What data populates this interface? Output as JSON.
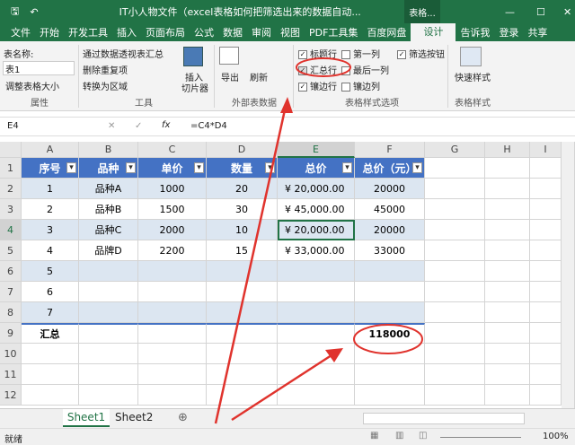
{
  "titlebar": {
    "title": "IT小人物文件（excel表格如何把筛选出来的数据自动...",
    "context": "表格...",
    "undo": "↶",
    "save": "🖫"
  },
  "tabs": [
    "文件",
    "开始",
    "开发工具",
    "插入",
    "页面布局",
    "公式",
    "数据",
    "审阅",
    "视图",
    "PDF工具集",
    "百度网盘",
    "设计"
  ],
  "tab_right": {
    "tell": "告诉我",
    "login": "登录",
    "share": "共享"
  },
  "ribbon": {
    "table_name_label": "表名称:",
    "table_name": "表1",
    "resize": "调整表格大小",
    "group_props": "属性",
    "pivot": "通过数据透视表汇总",
    "remove_dup": "删除重复项",
    "convert": "转换为区域",
    "slicer1": "插入",
    "slicer2": "切片器",
    "group_tools": "工具",
    "export": "导出",
    "refresh": "刷新",
    "group_ext": "外部表数据",
    "opts": [
      {
        "label": "标题行",
        "checked": true
      },
      {
        "label": "第一列",
        "checked": false
      },
      {
        "label": "筛选按钮",
        "checked": true
      },
      {
        "label": "汇总行",
        "checked": true
      },
      {
        "label": "最后一列",
        "checked": false
      },
      {
        "label": "镶边行",
        "checked": true
      },
      {
        "label": "镶边列",
        "checked": false
      }
    ],
    "group_opts": "表格样式选项",
    "quick_style": "快速样式",
    "group_style": "表格样式"
  },
  "formula": {
    "cell": "E4",
    "fx": "fx",
    "value": "=C4*D4"
  },
  "columns": [
    "A",
    "B",
    "C",
    "D",
    "E",
    "F",
    "G",
    "H",
    "I"
  ],
  "headers": [
    "序号",
    "品种",
    "单价",
    "数量",
    "总价",
    "总价（元）"
  ],
  "rows": [
    [
      "1",
      "品种A",
      "1000",
      "20",
      "¥  20,000.00",
      "20000"
    ],
    [
      "2",
      "品种B",
      "1500",
      "30",
      "¥  45,000.00",
      "45000"
    ],
    [
      "3",
      "品种C",
      "2000",
      "10",
      "¥  20,000.00",
      "20000"
    ],
    [
      "4",
      "品牌D",
      "2200",
      "15",
      "¥  33,000.00",
      "33000"
    ],
    [
      "5",
      "",
      "",
      "",
      "",
      ""
    ],
    [
      "6",
      "",
      "",
      "",
      "",
      ""
    ],
    [
      "7",
      "",
      "",
      "",
      "",
      ""
    ],
    [
      "汇总",
      "",
      "",
      "",
      "",
      "118000"
    ]
  ],
  "row_numbers": [
    "1",
    "2",
    "3",
    "4",
    "5",
    "6",
    "7",
    "8",
    "9",
    "10",
    "11",
    "12"
  ],
  "sheets": [
    "Sheet1",
    "Sheet2"
  ],
  "status": {
    "ready": "就绪",
    "zoom": "100%"
  },
  "colors": {
    "green": "#217346",
    "band": "#dce6f1",
    "header": "#4472c4",
    "annot": "#e0332d"
  }
}
